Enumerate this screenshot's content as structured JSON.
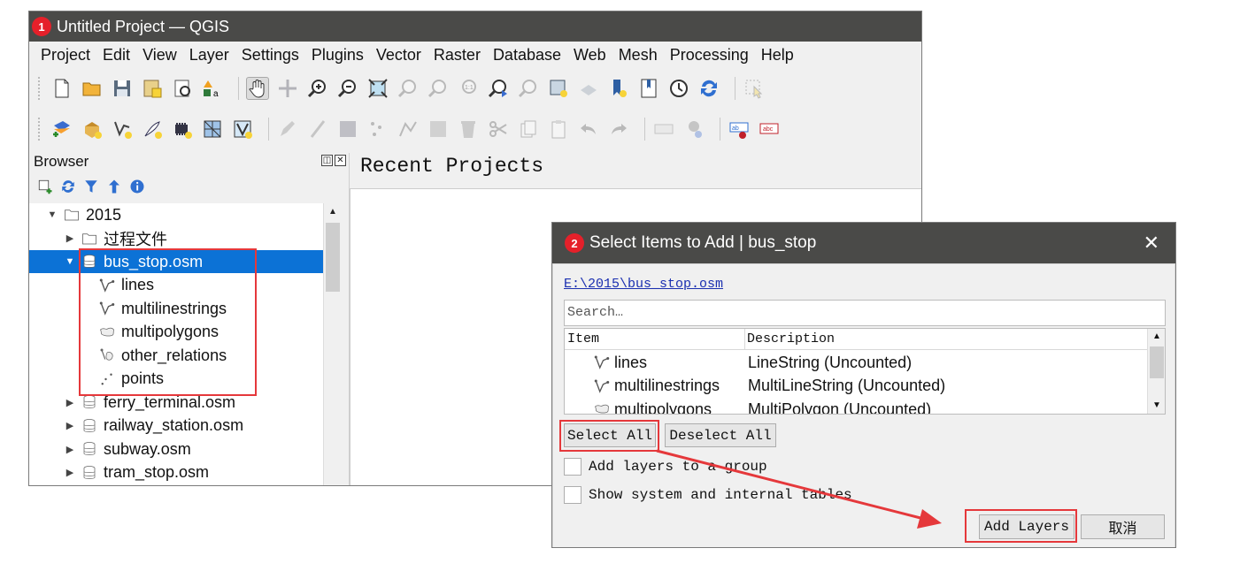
{
  "qgis": {
    "step": "1",
    "title": "Untitled Project — QGIS",
    "menu": [
      "Project",
      "Edit",
      "View",
      "Layer",
      "Settings",
      "Plugins",
      "Vector",
      "Raster",
      "Database",
      "Web",
      "Mesh",
      "Processing",
      "Help"
    ],
    "browser": {
      "title": "Browser",
      "tree": [
        {
          "label": "2015",
          "icon": "folder-icon",
          "arrow": "▼",
          "indent": 0
        },
        {
          "label": "过程文件",
          "icon": "folder-icon",
          "arrow": "▶",
          "indent": 1
        },
        {
          "label": "bus_stop.osm",
          "icon": "database-icon",
          "arrow": "▼",
          "indent": 1,
          "selected": true
        },
        {
          "label": "lines",
          "icon": "line-layer-icon",
          "arrow": "",
          "indent": 2
        },
        {
          "label": "multilinestrings",
          "icon": "line-layer-icon",
          "arrow": "",
          "indent": 2
        },
        {
          "label": "multipolygons",
          "icon": "polygon-layer-icon",
          "arrow": "",
          "indent": 2
        },
        {
          "label": "other_relations",
          "icon": "geometry-collection-icon",
          "arrow": "",
          "indent": 2
        },
        {
          "label": "points",
          "icon": "point-layer-icon",
          "arrow": "",
          "indent": 2
        },
        {
          "label": "ferry_terminal.osm",
          "icon": "database-icon",
          "arrow": "▶",
          "indent": 1
        },
        {
          "label": "railway_station.osm",
          "icon": "database-icon",
          "arrow": "▶",
          "indent": 1
        },
        {
          "label": "subway.osm",
          "icon": "database-icon",
          "arrow": "▶",
          "indent": 1
        },
        {
          "label": "tram_stop.osm",
          "icon": "database-icon",
          "arrow": "▶",
          "indent": 1
        }
      ]
    },
    "recent_title": "Recent Projects"
  },
  "dialog": {
    "step": "2",
    "title": "Select Items to Add | bus_stop",
    "path_link": "E:\\2015\\bus_stop.osm",
    "search_placeholder": "Search…",
    "columns": [
      "Item",
      "Description"
    ],
    "rows": [
      {
        "item": "lines",
        "desc": "LineString (Uncounted)",
        "icon": "line-layer-icon"
      },
      {
        "item": "multilinestrings",
        "desc": "MultiLineString (Uncounted)",
        "icon": "line-layer-icon"
      },
      {
        "item": "multipolygons",
        "desc": "MultiPolygon (Uncounted)",
        "icon": "polygon-layer-icon"
      }
    ],
    "select_all": "Select All",
    "deselect_all": "Deselect All",
    "add_to_group": "Add layers to a group",
    "show_system": "Show system and internal tables",
    "add_layers": "Add Layers",
    "cancel": "取消"
  },
  "colors": {
    "highlight": "#e5383b",
    "selection": "#0c72d6",
    "titlebar": "#4a4a48"
  }
}
